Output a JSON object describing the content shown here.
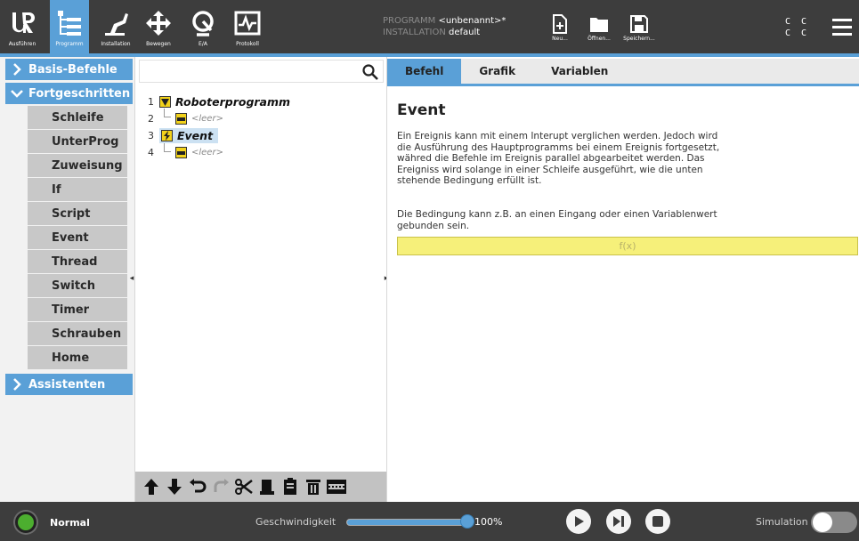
{
  "topbar": {
    "nav": [
      {
        "label": "Ausführen",
        "icon": "ur-logo-icon"
      },
      {
        "label": "Programm",
        "icon": "program-tree-icon",
        "active": true
      },
      {
        "label": "Installation",
        "icon": "installation-icon"
      },
      {
        "label": "Bewegen",
        "icon": "move-arrows-icon"
      },
      {
        "label": "E/A",
        "icon": "io-icon"
      },
      {
        "label": "Protokoll",
        "icon": "log-icon"
      }
    ],
    "program_key": "PROGRAMM",
    "program_value": "<unbenannt>*",
    "installation_key": "INSTALLATION",
    "installation_value": "default",
    "file_buttons": [
      {
        "label": "Neu...",
        "icon": "new-file-icon"
      },
      {
        "label": "Öffnen...",
        "icon": "folder-icon"
      },
      {
        "label": "Speichern...",
        "icon": "save-icon"
      }
    ],
    "cc_line1": "C C",
    "cc_line2": "C C",
    "accent": "#5aa0d7"
  },
  "sidebar": {
    "basic_label": "Basis-Befehle",
    "advanced_label": "Fortgeschritten",
    "advanced_items": [
      "Schleife",
      "UnterProg",
      "Zuweisung",
      "If",
      "Script",
      "Event",
      "Thread",
      "Switch",
      "Timer",
      "Schrauben",
      "Home"
    ],
    "wizards_label": "Assistenten"
  },
  "tree": {
    "search_placeholder": "",
    "rows": [
      {
        "num": "1",
        "label": "Roboterprogramm"
      },
      {
        "num": "2",
        "label": "<leer>"
      },
      {
        "num": "3",
        "label": "Event"
      },
      {
        "num": "4",
        "label": "<leer>"
      }
    ]
  },
  "detail": {
    "tabs": [
      "Befehl",
      "Grafik",
      "Variablen"
    ],
    "active_tab": "Befehl",
    "title": "Event",
    "para1_lines": [
      "Ein Ereignis kann mit einem Interupt verglichen werden. Jedoch wird",
      "die Ausführung des Hauptprogramms bei einem Ereignis fortgesetzt,",
      "währed die Befehle im Ereignis parallel abgearbeitet werden. Das",
      "Ereigniss wird solange in einer Schleife ausgeführt, wie die unten",
      "stehende Bedingung erfüllt ist."
    ],
    "para2_lines": [
      "Die Bedingung kann z.B. an einen Eingang oder einen Variablenwert",
      "gebunden sein."
    ],
    "fx_label": "f(x)"
  },
  "bottombar": {
    "status": "Normal",
    "status_color": "#4cae2f",
    "speed_label": "Geschwindigkeit",
    "speed_value": "100%",
    "speed_fraction": 1.0,
    "simulation_label": "Simulation"
  }
}
